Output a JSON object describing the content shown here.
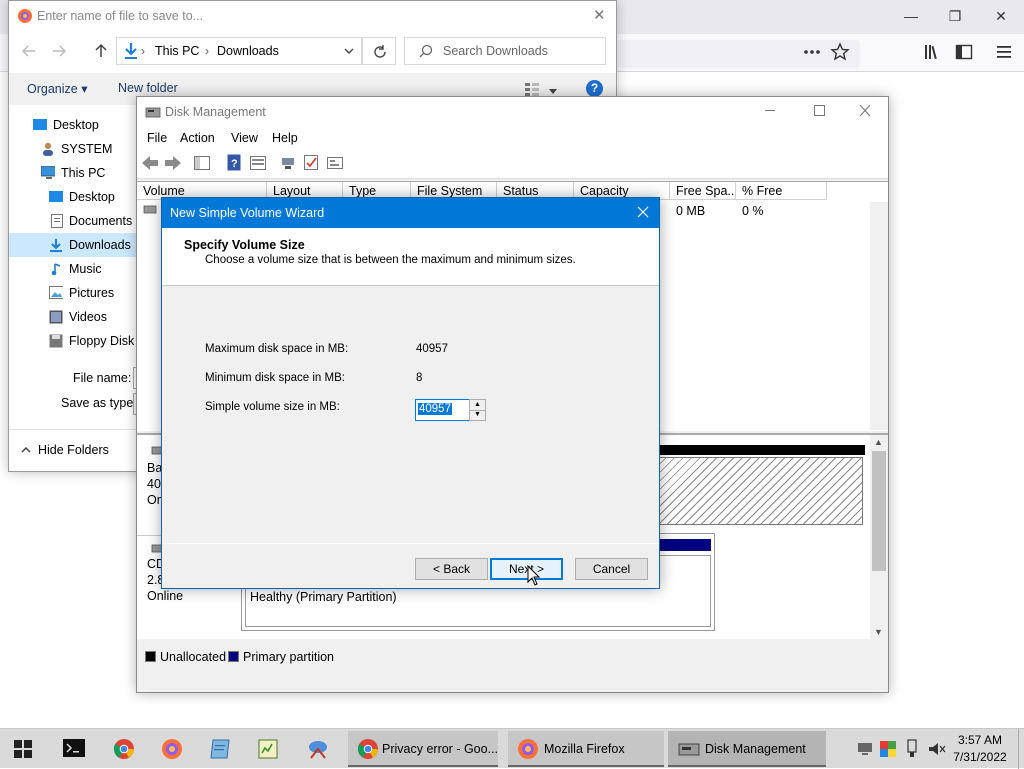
{
  "firefox": {
    "caption_buttons": [
      "—",
      "❐",
      "✕"
    ],
    "toolbar_icons": [
      "more-icon",
      "bookmark-star-icon",
      "library-icon",
      "sidebar-icon",
      "menu-icon"
    ]
  },
  "save_dialog": {
    "title": "Enter name of file to save to...",
    "close": "✕",
    "breadcrumb": [
      "This PC",
      "Downloads"
    ],
    "breadcrumb_sep": "›",
    "search_placeholder": "Search Downloads",
    "organize": "Organize ▾",
    "new_folder": "New folder",
    "tree": [
      {
        "label": "Desktop",
        "icon": "desktop-icon"
      },
      {
        "label": "SYSTEM",
        "icon": "user-icon"
      },
      {
        "label": "This PC",
        "icon": "computer-icon"
      },
      {
        "label": "Desktop",
        "icon": "desktop-icon"
      },
      {
        "label": "Documents",
        "icon": "documents-icon"
      },
      {
        "label": "Downloads",
        "icon": "downloads-icon",
        "selected": true
      },
      {
        "label": "Music",
        "icon": "music-icon"
      },
      {
        "label": "Pictures",
        "icon": "pictures-icon"
      },
      {
        "label": "Videos",
        "icon": "videos-icon"
      },
      {
        "label": "Floppy Disk D",
        "icon": "floppy-icon"
      }
    ],
    "file_name_label": "File name:",
    "save_as_type_label": "Save as type:",
    "hide_folders": "Hide Folders"
  },
  "disk_mgmt": {
    "title": "Disk Management",
    "menu": [
      "File",
      "Action",
      "View",
      "Help"
    ],
    "columns": [
      "Volume",
      "Layout",
      "Type",
      "File System",
      "Status",
      "Capacity",
      "Free Spa...",
      "% Free"
    ],
    "row": {
      "free_space": "0 MB",
      "pct_free": "0 %"
    },
    "disk0": {
      "name": "Ba",
      "size": "40.",
      "state": "On"
    },
    "cdrom": {
      "name": "CD",
      "size": "2.8",
      "state": "Online",
      "partition_status": "Healthy (Primary Partition)"
    },
    "legend": [
      {
        "label": "Unallocated",
        "color": "#000000"
      },
      {
        "label": "Primary partition",
        "color": "#000080"
      }
    ]
  },
  "wizard": {
    "title": "New Simple Volume Wizard",
    "heading": "Specify Volume Size",
    "subheading": "Choose a volume size that is between the maximum and minimum sizes.",
    "max_label": "Maximum disk space in MB:",
    "max_value": "40957",
    "min_label": "Minimum disk space in MB:",
    "min_value": "8",
    "size_label": "Simple volume size in MB:",
    "size_value": "40957",
    "back": "< Back",
    "next": "Next >",
    "cancel": "Cancel"
  },
  "taskbar": {
    "tasks": [
      {
        "label": "Privacy error - Goo...",
        "icon": "chrome-icon"
      },
      {
        "label": "Mozilla Firefox",
        "icon": "firefox-icon"
      },
      {
        "label": "Disk Management",
        "icon": "disk-management-icon",
        "active": true
      }
    ],
    "time": "3:57 AM",
    "date": "7/31/2022"
  }
}
